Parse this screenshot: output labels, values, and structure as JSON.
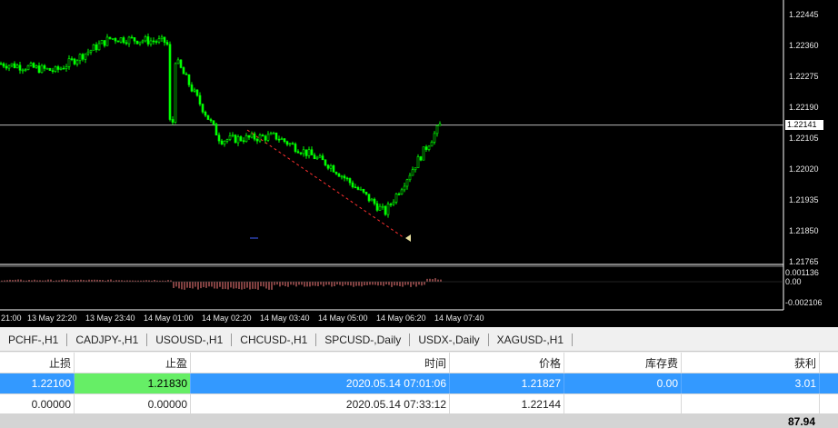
{
  "chart": {
    "symbol_hint": "",
    "colors": {
      "background": "#000000",
      "candles": "#00ff00",
      "grid": "#ffffff",
      "trendline": "#ff3030",
      "oscillator": "#ff8080"
    },
    "price_labels": [
      "1.22445",
      "1.22360",
      "1.22275",
      "1.22190",
      "1.22105",
      "1.22020",
      "1.21935",
      "1.21850",
      "1.21765"
    ],
    "current_price": "1.22141",
    "oscillator_labels": [
      "0.001136",
      "0.00",
      "-0.002106"
    ],
    "time_labels": [
      "21:00",
      "13 May 22:20",
      "13 May 23:40",
      "14 May 01:00",
      "14 May 02:20",
      "14 May 03:40",
      "14 May 05:00",
      "14 May 06:20",
      "14 May 07:40"
    ]
  },
  "chart_data": {
    "type": "line",
    "title": "",
    "xlabel": "",
    "ylabel": "",
    "ylim": [
      1.21765,
      1.22445
    ],
    "x": [
      "21:00",
      "13 May 22:20",
      "13 May 23:40",
      "14 May 01:00",
      "14 May 02:20",
      "14 May 03:40",
      "14 May 05:00",
      "14 May 06:20",
      "14 May 07:40"
    ],
    "series": [
      {
        "values": [
          1.2231,
          1.2229,
          1.2238,
          1.2237,
          1.221,
          1.2211,
          1.2203,
          1.219,
          1.2214
        ]
      }
    ]
  },
  "tabs": [
    "PCHF-,H1",
    "CADJPY-,H1",
    "USOUSD-,H1",
    "CHCUSD-,H1",
    "SPCUSD-,Daily",
    "USDX-,Daily",
    "XAGUSD-,H1"
  ],
  "table": {
    "headers": [
      "止损",
      "止盈",
      "时间",
      "价格",
      "库存费",
      "获利"
    ],
    "rows": [
      [
        "1.22100",
        "1.21830",
        "2020.05.14 07:01:06",
        "1.21827",
        "0.00",
        "3.01"
      ],
      [
        "0.00000",
        "0.00000",
        "2020.05.14 07:33:12",
        "1.22144",
        "",
        ""
      ]
    ]
  },
  "footer": {
    "total": "87.94"
  }
}
